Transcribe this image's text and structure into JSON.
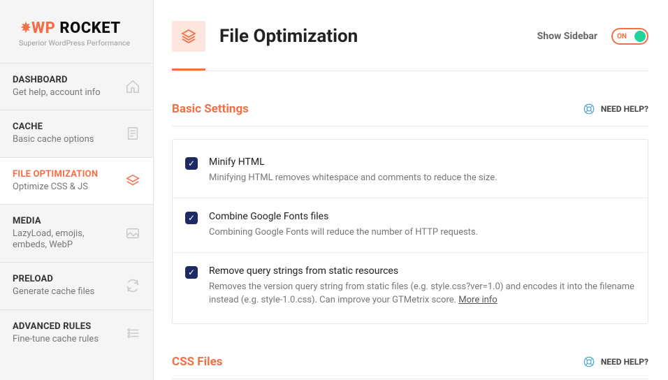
{
  "logo": {
    "brand_part1": "WP",
    "brand_part2": " ROCKET",
    "subtitle": "Superior WordPress Performance"
  },
  "sidebar": {
    "items": [
      {
        "title": "DASHBOARD",
        "subtitle": "Get help, account info",
        "icon": "home"
      },
      {
        "title": "CACHE",
        "subtitle": "Basic cache options",
        "icon": "file"
      },
      {
        "title": "FILE OPTIMIZATION",
        "subtitle": "Optimize CSS & JS",
        "icon": "layers",
        "active": true
      },
      {
        "title": "MEDIA",
        "subtitle": "LazyLoad, emojis, embeds, WebP",
        "icon": "image"
      },
      {
        "title": "PRELOAD",
        "subtitle": "Generate cache files",
        "icon": "refresh"
      },
      {
        "title": "ADVANCED RULES",
        "subtitle": "Fine-tune cache rules",
        "icon": "sliders"
      }
    ]
  },
  "header": {
    "title": "File Optimization",
    "show_sidebar": "Show Sidebar",
    "toggle_label": "ON"
  },
  "sections": {
    "basic": {
      "title": "Basic Settings",
      "need_help": "NEED HELP?",
      "rows": [
        {
          "label": "Minify HTML",
          "desc": "Minifying HTML removes whitespace and comments to reduce the size.",
          "checked": true
        },
        {
          "label": "Combine Google Fonts files",
          "desc": "Combining Google Fonts will reduce the number of HTTP requests.",
          "checked": true
        },
        {
          "label": "Remove query strings from static resources",
          "desc": "Removes the version query string from static files (e.g. style.css?ver=1.0) and encodes it into the filename instead (e.g. style-1.0.css). Can improve your GTMetrix score. ",
          "more": "More info",
          "checked": true
        }
      ]
    },
    "css": {
      "title": "CSS Files",
      "need_help": "NEED HELP?"
    }
  }
}
